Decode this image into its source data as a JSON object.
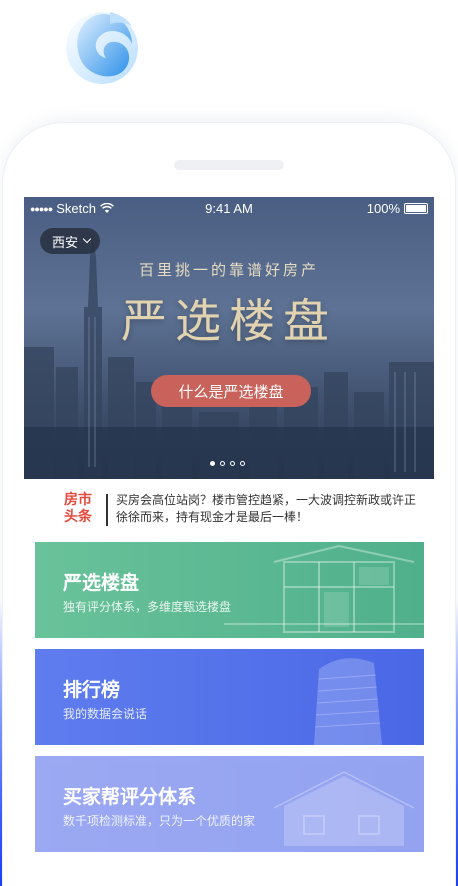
{
  "status_bar": {
    "carrier": "Sketch",
    "time": "9:41 AM",
    "battery": "100%"
  },
  "hero": {
    "city": "西安",
    "slogan": "百里挑一的靠谱好房产",
    "title": "严选楼盘",
    "button_label": "什么是严选楼盘",
    "page_count": 4,
    "active_page": 1
  },
  "news": {
    "badge_line1": "房市",
    "badge_line2": "头条",
    "text": "买房会高位站岗？楼市管控趋紧，一大波调控新政或许正徐徐而来，持有现金才是最后一棒！"
  },
  "cards": [
    {
      "title": "严选楼盘",
      "subtitle": "独有评分体系，多维度甄选楼盘"
    },
    {
      "title": "排行榜",
      "subtitle": "我的数据会说话"
    },
    {
      "title": "买家帮评分体系",
      "subtitle": "数千项检测标准，只为一个优质的家"
    }
  ],
  "colors": {
    "accent_red": "#c9625a",
    "card_green": "#5cb892",
    "card_blue": "#5673ea"
  },
  "icons": {
    "logo": "app-logo-swirl",
    "wifi": "wifi-icon",
    "battery": "battery-icon",
    "dropdown": "chevron-down-icon"
  }
}
